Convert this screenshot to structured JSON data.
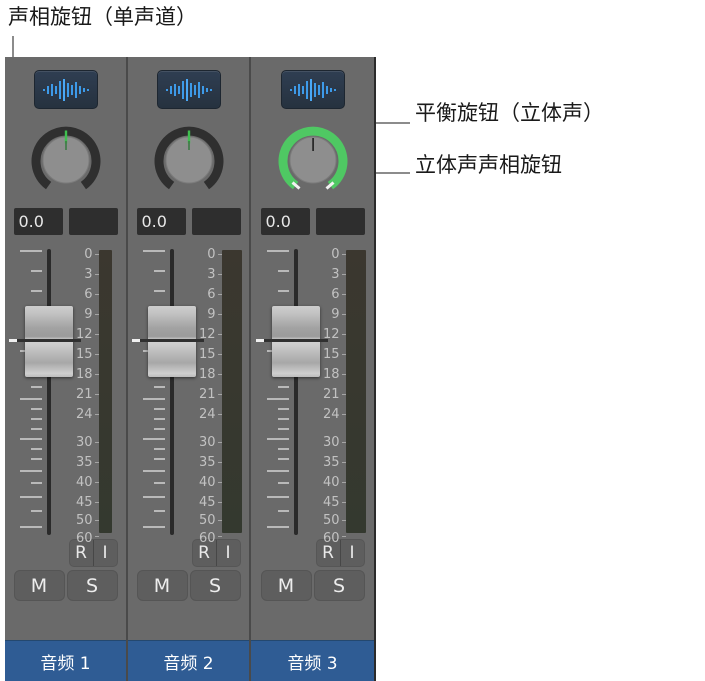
{
  "annotations": {
    "mono_pan_label": "声相旋钮（单声道）",
    "balance_label": "平衡旋钮（立体声）",
    "stereo_pan_label": "立体声声相旋钮"
  },
  "colors": {
    "panel_background": "#6a6a6a",
    "panel_border": "#2b2b2b",
    "track_name_background": "#2f5c94",
    "knob_indicator_green": "#3fbf4f",
    "knob_ring_active": "#4fc863",
    "knob_ring_inactive": "#2f2f2f",
    "input_button_background": "#2f3e52",
    "waveform_blue": "#3d9ae8",
    "value_field_background": "#2e2e2e",
    "callout_line": "#8c8c8c"
  },
  "meter_scale": {
    "labels": [
      "0",
      "3",
      "6",
      "9",
      "12",
      "15",
      "18",
      "21",
      "24",
      "30",
      "35",
      "40",
      "45",
      "50",
      "60"
    ],
    "positions_pct": [
      1,
      7.5,
      14,
      20.5,
      27.5,
      34,
      40.5,
      47.5,
      54.5,
      64.5,
      71.5,
      78.5,
      85.5,
      92,
      98.5
    ]
  },
  "channels": [
    {
      "name": "音频 1",
      "input_icon": "waveform-icon",
      "knob": {
        "type": "mono-pan",
        "ring_active": false,
        "indicator_color": "#3fbf4f",
        "indicator_angle": 0
      },
      "value_primary": "0.0",
      "value_secondary": "",
      "fader_position_pct": 23,
      "meter_mode": "mono",
      "buttons": {
        "record": "R",
        "input": "I",
        "mute": "M",
        "solo": "S"
      }
    },
    {
      "name": "音频 2",
      "input_icon": "waveform-icon",
      "knob": {
        "type": "balance",
        "ring_active": false,
        "indicator_color": "#3fbf4f",
        "indicator_angle": 0
      },
      "value_primary": "0.0",
      "value_secondary": "",
      "fader_position_pct": 23,
      "meter_mode": "stereo",
      "buttons": {
        "record": "R",
        "input": "I",
        "mute": "M",
        "solo": "S"
      }
    },
    {
      "name": "音频 3",
      "input_icon": "waveform-icon",
      "knob": {
        "type": "stereo-pan",
        "ring_active": true,
        "indicator_color": "#2a2a2a",
        "indicator_angle": 0
      },
      "value_primary": "0.0",
      "value_secondary": "",
      "fader_position_pct": 23,
      "meter_mode": "stereo",
      "buttons": {
        "record": "R",
        "input": "I",
        "mute": "M",
        "solo": "S"
      }
    }
  ]
}
